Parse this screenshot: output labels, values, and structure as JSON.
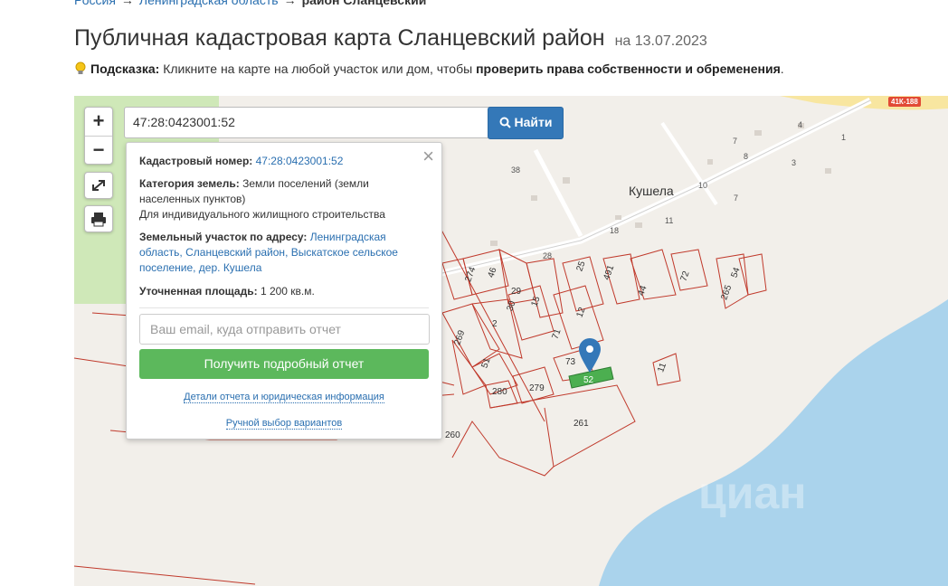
{
  "breadcrumb": {
    "root": "Россия",
    "arrow": "→",
    "region": "Ленинградская область",
    "district": "район Сланцевский"
  },
  "page": {
    "title": "Публичная кадастровая карта Сланцевский район",
    "date": "на 13.07.2023"
  },
  "hint": {
    "label": "Подсказка:",
    "text": "Кликните на карте на любой участок или дом, чтобы",
    "bold": "проверить права собственности и обременения",
    "end": "."
  },
  "map": {
    "zoom_in": "+",
    "zoom_out": "−",
    "search_value": "47:28:0423001:52",
    "find_label": "Найти",
    "town": "Кушела",
    "road_badge": "41К-188",
    "watermark": "циан",
    "house_numbers": [
      "4",
      "1",
      "7",
      "8",
      "3",
      "10",
      "7",
      "11",
      "18",
      "38",
      "28"
    ],
    "parcel_numbers": [
      "274",
      "46",
      "25",
      "16",
      "491",
      "44",
      "72",
      "54",
      "265",
      "15",
      "30",
      "2",
      "12",
      "71",
      "269",
      "51",
      "73",
      "280",
      "279",
      "11",
      "261",
      "260",
      "29",
      "52"
    ]
  },
  "popup": {
    "close": "×",
    "cad_label": "Кадастровый номер:",
    "cad_value": "47:28:0423001:52",
    "cat_label": "Категория земель:",
    "cat_value": "Земли поселений (земли населенных пунктов)",
    "use_value": "Для индивидуального жилищного строительства",
    "addr_label": "Земельный участок по адресу:",
    "addr_value": "Ленинградская область, Сланцевский район, Выскатское сельское поселение, дер. Кушела",
    "area_label": "Уточненная площадь:",
    "area_value": "1 200 кв.м.",
    "email_placeholder": "Ваш email, куда отправить отчет",
    "report_button": "Получить подробный отчет",
    "details_link": "Детали отчета и юридическая информация",
    "manual_link": "Ручной выбор вариантов"
  }
}
